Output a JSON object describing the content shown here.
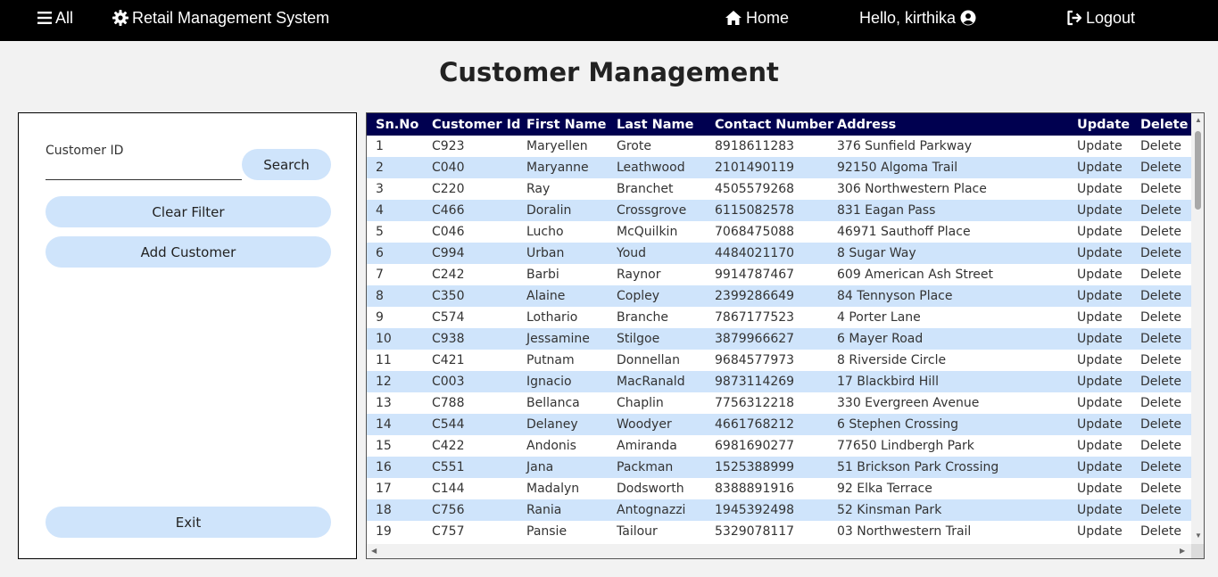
{
  "navbar": {
    "menu_label": "All",
    "brand": "Retail Management System",
    "home_label": "Home",
    "greeting": "Hello, kirthika",
    "logout_label": "Logout"
  },
  "page": {
    "title": "Customer Management"
  },
  "filter": {
    "customer_id_label": "Customer ID",
    "customer_id_value": "",
    "search_label": "Search",
    "clear_label": "Clear Filter",
    "add_label": "Add Customer",
    "exit_label": "Exit"
  },
  "table": {
    "headers": [
      "Sn.No",
      "Customer Id",
      "First Name",
      "Last Name",
      "Contact Number",
      "Address",
      "Update",
      "Delete"
    ],
    "rows": [
      [
        "1",
        "C923",
        "Maryellen",
        "Grote",
        "8918611283",
        "376 Sunfield Parkway",
        "Update",
        "Delete"
      ],
      [
        "2",
        "C040",
        "Maryanne",
        "Leathwood",
        "2101490119",
        "92150 Algoma Trail",
        "Update",
        "Delete"
      ],
      [
        "3",
        "C220",
        "Ray",
        "Branchet",
        "4505579268",
        "306 Northwestern Place",
        "Update",
        "Delete"
      ],
      [
        "4",
        "C466",
        "Doralin",
        "Crossgrove",
        "6115082578",
        "831 Eagan Pass",
        "Update",
        "Delete"
      ],
      [
        "5",
        "C046",
        "Lucho",
        "McQuilkin",
        "7068475088",
        "46971 Sauthoff Place",
        "Update",
        "Delete"
      ],
      [
        "6",
        "C994",
        "Urban",
        "Youd",
        "4484021170",
        "8 Sugar Way",
        "Update",
        "Delete"
      ],
      [
        "7",
        "C242",
        "Barbi",
        "Raynor",
        "9914787467",
        "609 American Ash Street",
        "Update",
        "Delete"
      ],
      [
        "8",
        "C350",
        "Alaine",
        "Copley",
        "2399286649",
        "84 Tennyson Place",
        "Update",
        "Delete"
      ],
      [
        "9",
        "C574",
        "Lothario",
        "Branche",
        "7867177523",
        "4 Porter Lane",
        "Update",
        "Delete"
      ],
      [
        "10",
        "C938",
        "Jessamine",
        "Stilgoe",
        "3879966627",
        "6 Mayer Road",
        "Update",
        "Delete"
      ],
      [
        "11",
        "C421",
        "Putnam",
        "Donnellan",
        "9684577973",
        "8 Riverside Circle",
        "Update",
        "Delete"
      ],
      [
        "12",
        "C003",
        "Ignacio",
        "MacRanald",
        "9873114269",
        "17 Blackbird Hill",
        "Update",
        "Delete"
      ],
      [
        "13",
        "C788",
        "Bellanca",
        "Chaplin",
        "7756312218",
        "330 Evergreen Avenue",
        "Update",
        "Delete"
      ],
      [
        "14",
        "C544",
        "Delaney",
        "Woodyer",
        "4661768212",
        "6 Stephen Crossing",
        "Update",
        "Delete"
      ],
      [
        "15",
        "C422",
        "Andonis",
        "Amiranda",
        "6981690277",
        "77650 Lindbergh Park",
        "Update",
        "Delete"
      ],
      [
        "16",
        "C551",
        "Jana",
        "Packman",
        "1525388999",
        "51 Brickson Park Crossing",
        "Update",
        "Delete"
      ],
      [
        "17",
        "C144",
        "Madalyn",
        "Dodsworth",
        "8388891916",
        "92 Elka Terrace",
        "Update",
        "Delete"
      ],
      [
        "18",
        "C756",
        "Rania",
        "Antognazzi",
        "1945392498",
        "52 Kinsman Park",
        "Update",
        "Delete"
      ],
      [
        "19",
        "C757",
        "Pansie",
        "Tailour",
        "5329078117",
        "03 Northwestern Trail",
        "Update",
        "Delete"
      ]
    ]
  },
  "icons": {
    "menu": "hamburger-icon",
    "brand": "gear-icon",
    "home": "home-icon",
    "user": "user-circle-icon",
    "logout": "logout-icon"
  },
  "colors": {
    "navbar_bg": "#000000",
    "table_header_bg": "#000050",
    "row_alt_bg": "#cfe4fb",
    "button_bg": "#cfe4fb"
  }
}
